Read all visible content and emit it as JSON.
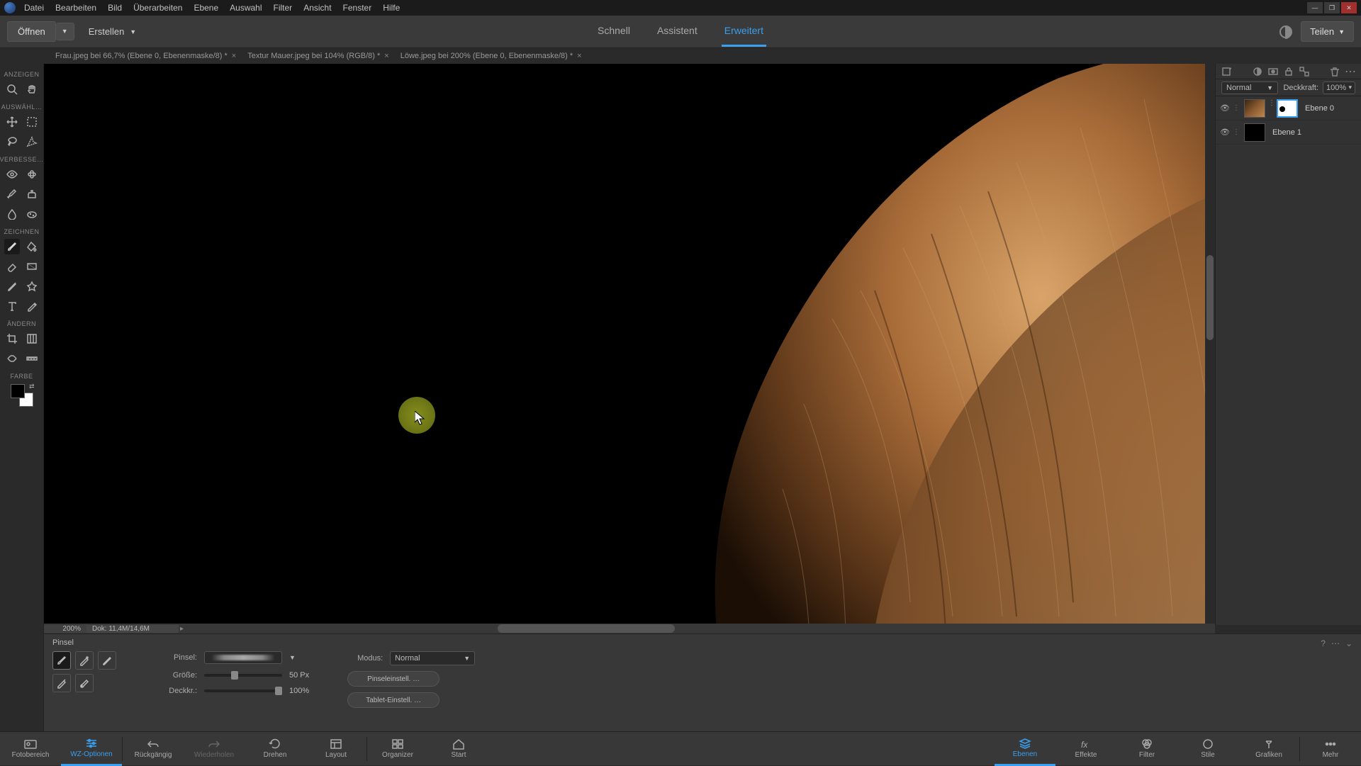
{
  "menu": {
    "datei": "Datei",
    "bearbeiten": "Bearbeiten",
    "bild": "Bild",
    "ueberarbeiten": "Überarbeiten",
    "ebene": "Ebene",
    "auswahl": "Auswahl",
    "filter": "Filter",
    "ansicht": "Ansicht",
    "fenster": "Fenster",
    "hilfe": "Hilfe"
  },
  "toolbar": {
    "open": "Öffnen",
    "create": "Erstellen",
    "share": "Teilen"
  },
  "modes": {
    "quick": "Schnell",
    "guided": "Assistent",
    "expert": "Erweitert"
  },
  "docTabs": [
    {
      "label": "Frau.jpeg bei 66,7% (Ebene 0, Ebenenmaske/8) *"
    },
    {
      "label": "Textur Mauer.jpeg bei 104% (RGB/8) *"
    },
    {
      "label": "Löwe.jpeg bei 200% (Ebene 0, Ebenenmaske/8) *"
    }
  ],
  "toolSections": {
    "anzeigen": "ANZEIGEN",
    "auswaehlen": "AUSWÄHL…",
    "verbessern": "VERBESSE…",
    "zeichnen": "ZEICHNEN",
    "aendern": "ÄNDERN",
    "farbe": "FARBE"
  },
  "status": {
    "zoom": "200%",
    "doc": "Dok: 11,4M/14,6M"
  },
  "toolOptions": {
    "toolName": "Pinsel",
    "brushLabel": "Pinsel:",
    "sizeLabel": "Größe:",
    "sizeValue": "50 Px",
    "opacityLabel": "Deckkr.:",
    "opacityValue": "100%",
    "modeLabel": "Modus:",
    "modeValue": "Normal",
    "brushSettings": "Pinseleinstell. …",
    "tabletSettings": "Tablet-Einstell. …"
  },
  "bottom": {
    "fotobereich": "Fotobereich",
    "wzoptionen": "WZ-Optionen",
    "rueckgaengig": "Rückgängig",
    "wiederholen": "Wiederholen",
    "drehen": "Drehen",
    "layout": "Layout",
    "organizer": "Organizer",
    "start": "Start",
    "ebenen": "Ebenen",
    "effekte": "Effekte",
    "filter": "Filter",
    "stile": "Stile",
    "grafiken": "Grafiken",
    "mehr": "Mehr"
  },
  "layersPanel": {
    "blendMode": "Normal",
    "opacityLabel": "Deckkraft:",
    "opacityValue": "100%",
    "layers": [
      {
        "name": "Ebene 0"
      },
      {
        "name": "Ebene 1"
      }
    ]
  }
}
